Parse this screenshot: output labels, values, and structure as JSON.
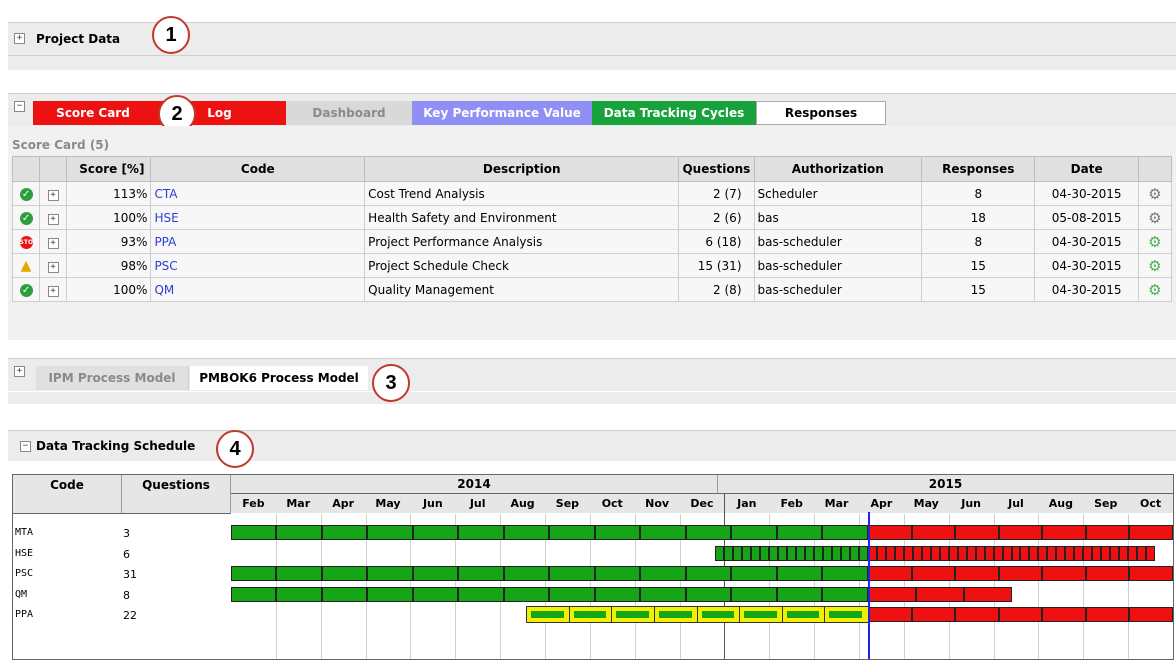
{
  "project_data": {
    "title": "Project Data",
    "callout": "1"
  },
  "tabs": {
    "score_card": "Score Card",
    "log": "Log",
    "dashboard": "Dashboard",
    "kpv": "Key Performance Value",
    "dtc": "Data Tracking Cycles",
    "responses": "Responses",
    "callout": "2"
  },
  "scorecard": {
    "title": "Score Card (5)",
    "headers": [
      "Score [%]",
      "Code",
      "Description",
      "Questions",
      "Authorization",
      "Responses",
      "Date"
    ],
    "rows": [
      {
        "status": "ok",
        "score": "113%",
        "code": "CTA",
        "description": "Cost Trend Analysis",
        "questions": "2 (7)",
        "authorization": "Scheduler",
        "responses": "8",
        "date": "04-30-2015",
        "gear": "gray"
      },
      {
        "status": "ok",
        "score": "100%",
        "code": "HSE",
        "description": "Health Safety and Environment",
        "questions": "2 (6)",
        "authorization": "bas",
        "responses": "18",
        "date": "05-08-2015",
        "gear": "gray"
      },
      {
        "status": "stop",
        "score": "93%",
        "code": "PPA",
        "description": "Project Performance Analysis",
        "questions": "6 (18)",
        "authorization": "bas-scheduler",
        "responses": "8",
        "date": "04-30-2015",
        "gear": "green"
      },
      {
        "status": "warn",
        "score": "98%",
        "code": "PSC",
        "description": "Project Schedule Check",
        "questions": "15 (31)",
        "authorization": "bas-scheduler",
        "responses": "15",
        "date": "04-30-2015",
        "gear": "green"
      },
      {
        "status": "ok",
        "score": "100%",
        "code": "QM",
        "description": "Quality Management",
        "questions": "2 (8)",
        "authorization": "bas-scheduler",
        "responses": "15",
        "date": "04-30-2015",
        "gear": "green"
      }
    ]
  },
  "process_tabs": {
    "ipm": "IPM Process Model",
    "pmbok": "PMBOK6 Process Model",
    "callout": "3"
  },
  "schedule": {
    "title": "Data Tracking Schedule",
    "callout": "4",
    "col_code": "Code",
    "col_questions": "Questions",
    "years": [
      "2014",
      "2015"
    ],
    "months": [
      "Feb",
      "Mar",
      "Apr",
      "May",
      "Jun",
      "Jul",
      "Aug",
      "Sep",
      "Oct",
      "Nov",
      "Dec",
      "Jan",
      "Feb",
      "Mar",
      "Apr",
      "May",
      "Jun",
      "Jul",
      "Aug",
      "Sep",
      "Oct"
    ],
    "current_month_index": 14.2,
    "rows": [
      {
        "code": "MTA",
        "questions": "3",
        "segments": [
          {
            "from": 0,
            "to": 14.2,
            "color": "green",
            "style": "solid"
          },
          {
            "from": 14.2,
            "to": 21,
            "color": "red",
            "style": "solid"
          }
        ]
      },
      {
        "code": "HSE",
        "questions": "6",
        "segments": [
          {
            "from": 10.8,
            "to": 14.2,
            "color": "green",
            "style": "dense"
          },
          {
            "from": 14.2,
            "to": 20.6,
            "color": "red",
            "style": "dense"
          }
        ]
      },
      {
        "code": "PSC",
        "questions": "31",
        "segments": [
          {
            "from": 0,
            "to": 14.2,
            "color": "green",
            "style": "solid"
          },
          {
            "from": 14.2,
            "to": 21,
            "color": "red",
            "style": "solid"
          }
        ]
      },
      {
        "code": "QM",
        "questions": "8",
        "segments": [
          {
            "from": 0,
            "to": 14.2,
            "color": "green",
            "style": "solid"
          },
          {
            "from": 14.2,
            "to": 17.4,
            "color": "red",
            "style": "solid"
          }
        ]
      },
      {
        "code": "PPA",
        "questions": "22",
        "segments": [
          {
            "from": 6.6,
            "to": 14.2,
            "color": "green",
            "style": "yellow"
          },
          {
            "from": 14.2,
            "to": 21,
            "color": "red",
            "style": "solid"
          }
        ]
      }
    ],
    "colors": {
      "green": "#16a516",
      "red": "#ee1111",
      "yellow": "#f0f000",
      "today": "#2222ee"
    }
  }
}
